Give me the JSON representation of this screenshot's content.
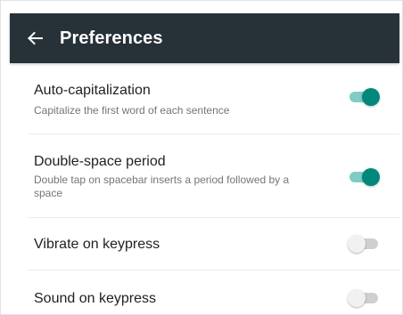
{
  "toolbar": {
    "title": "Preferences",
    "back_icon": "arrow-back-icon",
    "background": "#263238"
  },
  "preferences": [
    {
      "title": "Auto-capitalization",
      "summary": "Capitalize the first word of each sentence",
      "enabled": true
    },
    {
      "title": "Double-space period",
      "summary": "Double tap on spacebar inserts a period followed by a space",
      "enabled": true
    },
    {
      "title": "Vibrate on keypress",
      "summary": "",
      "enabled": false
    },
    {
      "title": "Sound on keypress",
      "summary": "",
      "enabled": false
    }
  ],
  "colors": {
    "accent": "#00897b",
    "accent_track": "#80cbc4",
    "off_track": "#cfcfcf"
  }
}
